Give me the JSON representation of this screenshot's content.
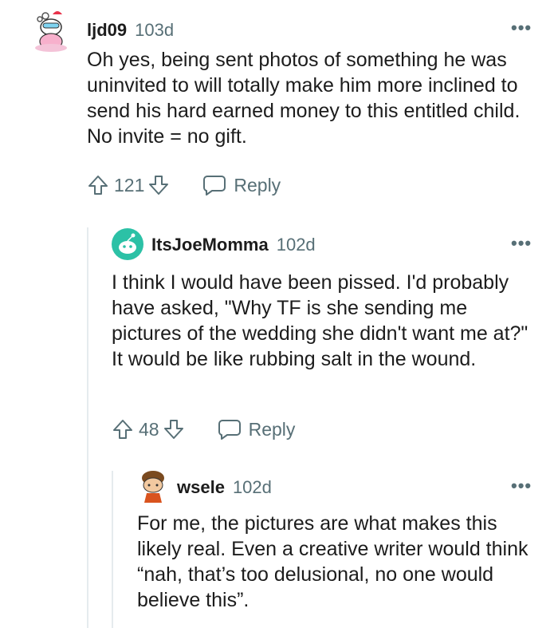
{
  "comments": [
    {
      "username": "ljd09",
      "age": "103d",
      "text": "Oh yes, being sent photos of something he was uninvited to will totally make him more inclined to send his hard earned money to this entitled child. No invite = no gift.",
      "upvotes": "121",
      "reply_label": "Reply"
    },
    {
      "username": "ItsJoeMomma",
      "age": "102d",
      "text": "I think I would have been pissed. I'd probably have asked, \"Why TF is she sending me pictures of the wedding she didn't want me at?\" It would be like rubbing salt in the wound.",
      "upvotes": "48",
      "reply_label": "Reply"
    },
    {
      "username": "wsele",
      "age": "102d",
      "text": "For me, the pictures are what makes this likely real. Even a creative writer would think “nah, that’s too delusional, no one would believe this”."
    }
  ],
  "icons": {
    "more": "more-options-icon",
    "upvote": "upvote-arrow-icon",
    "downvote": "downvote-arrow-icon",
    "reply": "speech-bubble-icon"
  },
  "colors": {
    "text": "#1c1c1c",
    "muted": "#576f76",
    "thread_line": "#e5ebee",
    "avatar2": "#2cc1a6"
  }
}
